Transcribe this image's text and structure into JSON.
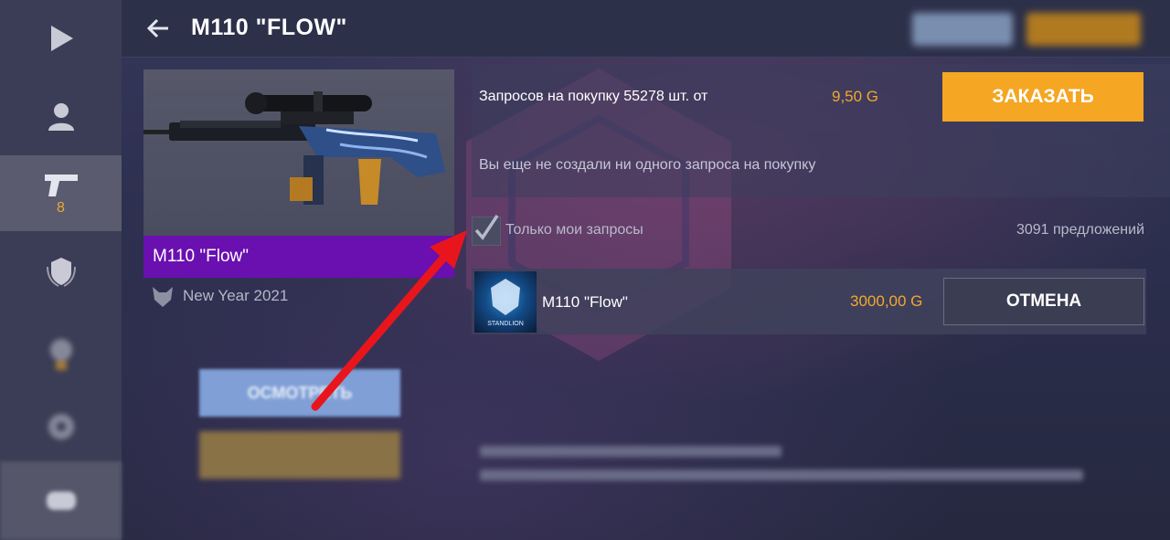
{
  "header": {
    "title": "M110 \"FLOW\""
  },
  "sidebar": {
    "weapons_count": "8"
  },
  "item": {
    "name": "M110 \"Flow\"",
    "collection": "New Year 2021",
    "inspect_label": "ОСМОТРЕТЬ"
  },
  "requests": {
    "summary": "Запросов на покупку 55278 шт. от",
    "price": "9,50 G",
    "order_label": "ЗАКАЗАТЬ",
    "empty_text": "Вы еще не создали ни одного запроса на покупку"
  },
  "filter": {
    "only_my_requests_label": "Только мои запросы",
    "checked": true,
    "offers_count": "3091 предложений"
  },
  "offers": [
    {
      "name": "M110 \"Flow\"",
      "price": "3000,00 G",
      "action_label": "ОТМЕНА",
      "thumb_text": "STANDLION"
    }
  ],
  "colors": {
    "accent_orange": "#f5a623",
    "price_orange": "#f0a830",
    "rarity_purple": "#6a0fb0",
    "annotation_red": "#e8161c"
  }
}
